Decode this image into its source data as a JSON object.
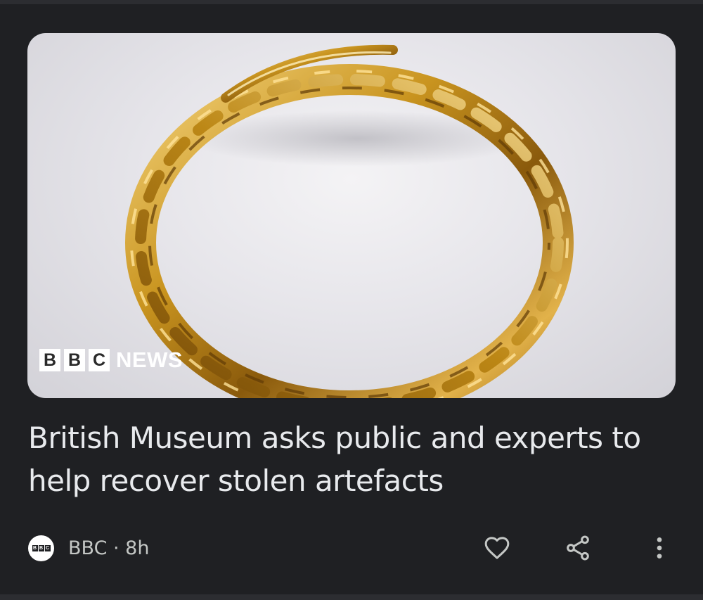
{
  "card": {
    "image_alt": "Twisted gold ring",
    "watermark": {
      "blocks": [
        "B",
        "B",
        "C"
      ],
      "word": "NEWS"
    },
    "headline": "British Museum asks public and experts to help recover stolen artefacts",
    "source": {
      "avatar_blocks": [
        "B",
        "B",
        "C"
      ],
      "meta": "BBC · 8h"
    },
    "actions": {
      "like_icon": "heart-icon",
      "share_icon": "share-icon",
      "more_icon": "more-vert-icon"
    }
  },
  "colors": {
    "background": "#1f2023",
    "headline_text": "#e8eaed",
    "meta_text": "#c4c7c5",
    "icon": "#c4c7c5",
    "gold": "#c9941f"
  }
}
